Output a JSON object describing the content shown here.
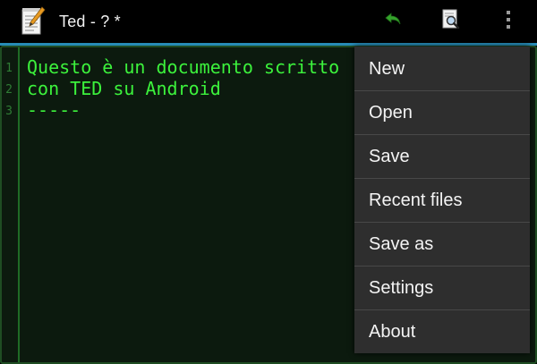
{
  "actionbar": {
    "title": "Ted - ? *",
    "app_icon": "notepad-pencil-icon",
    "undo_icon": "undo-icon",
    "search_icon": "search-document-icon",
    "overflow_icon": "overflow-menu-icon",
    "accent_color": "#2ea3d6"
  },
  "editor": {
    "line_numbers": [
      "1",
      "2",
      "3"
    ],
    "lines": [
      "Questo è un documento scritto",
      "con TED su Android",
      "-----"
    ],
    "text_color": "#3cf23c",
    "background_color": "#0c1a0e"
  },
  "menu": {
    "items": [
      {
        "label": "New"
      },
      {
        "label": "Open"
      },
      {
        "label": "Save"
      },
      {
        "label": "Recent files"
      },
      {
        "label": "Save as"
      },
      {
        "label": "Settings"
      },
      {
        "label": "About"
      }
    ]
  }
}
